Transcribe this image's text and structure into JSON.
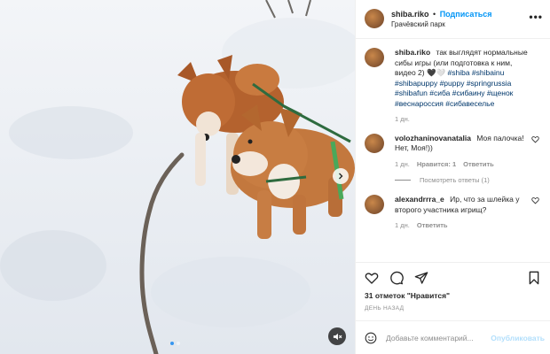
{
  "header": {
    "username": "shiba.riko",
    "separator": "•",
    "follow_label": "Подписаться",
    "location": "Грачёвский парк",
    "more_label": "•••"
  },
  "caption": {
    "username": "shiba.riko",
    "text": "так выглядят нормальные сибы игры (или подготовка к ним, видео 2) 🖤🤍",
    "hashtags": "#shiba #shibainu #shibapuppy #puppy #springrussia #shibafun #сиба #сибаину #щенок #веснароссия #сибавеселье",
    "time": "1 дн."
  },
  "comments": [
    {
      "username": "volozhaninovanatalia",
      "text": "Моя палочка! Нет, Моя!))",
      "time": "1 дн.",
      "likes": "Нравится: 1",
      "reply": "Ответить",
      "view_replies": "Посмотреть ответы (1)"
    },
    {
      "username": "alexandrrra_e",
      "text": "Ир, что за шлейка у второго участника игрищ?",
      "time": "1 дн.",
      "reply": "Ответить"
    }
  ],
  "likes": {
    "count": "31 отметок",
    "label": "\"Нравится\""
  },
  "date": "ДЕНЬ НАЗАД",
  "add_comment": {
    "placeholder": "Добавьте комментарий...",
    "publish_label": "Опубликовать"
  },
  "colors": {
    "accent": "#0095f6",
    "publish_disabled": "#b2dffc",
    "muted": "#8e8e8e",
    "hashtag": "#00376b"
  }
}
